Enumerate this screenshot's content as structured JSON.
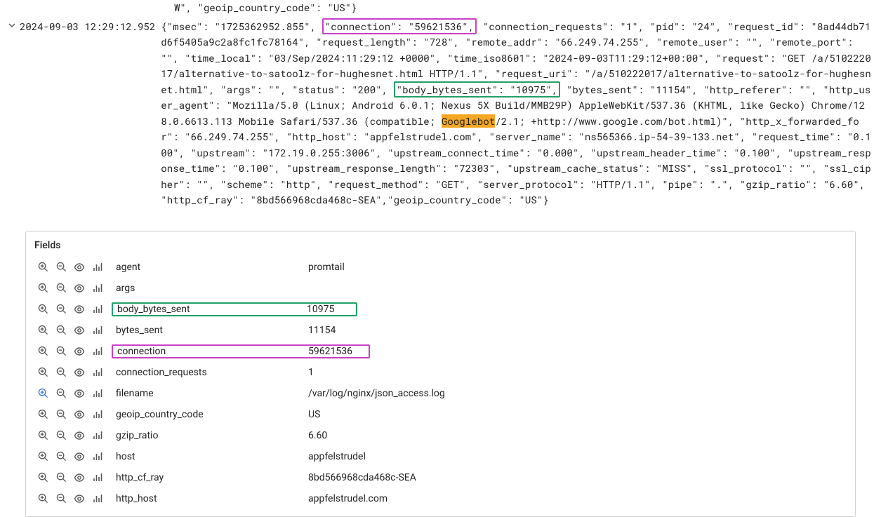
{
  "top_fragment": "W\", \"geoip_country_code\": \"US\"}",
  "timestamp": "2024-09-03 12:29:12.952",
  "log_prefix": "{\"msec\": \"1725362952.855\", ",
  "log_conn_span": "\"connection\": \"59621536\",",
  "log_mid1": " \"connection_requests\": \"1\", \"pid\": \"24\", \"request_id\": \"8ad44db71d6f5405a9c2a8fc1fc78164\", \"request_length\": \"728\", \"remote_addr\": \"66.249.74.255\", \"remote_user\": \"\", \"remote_port\": \"\", \"time_local\": \"03/Sep/2024:11:29:12 +0000\", \"time_iso8601\": \"2024-09-03T11:29:12+00:00\", \"request\": \"GET /a/510222017/alternative-to-satoolz-for-hughesnet.html HTTP/1.1\", \"request_uri\": \"/a/510222017/alternative-to-satoolz-for-hughesnet.html\", \"args\": \"\", \"status\": \"200\", ",
  "log_body_span": "\"body_bytes_sent\": \"10975\",",
  "log_mid2": " \"bytes_sent\": \"11154\", \"http_referer\": \"\", \"http_user_agent\": \"Mozilla/5.0 (Linux; Android 6.0.1; Nexus 5X Build/MMB29P) AppleWebKit/537.36 (KHTML, like Gecko) Chrome/128.0.6613.113 Mobile Safari/537.36 (compatible; ",
  "log_googlebot": "Googlebot",
  "log_suffix": "/2.1; +http://www.google.com/bot.html)\", \"http_x_forwarded_for\": \"66.249.74.255\", \"http_host\": \"appfelstrudel.com\", \"server_name\": \"ns565366.ip-54-39-133.net\", \"request_time\": \"0.100\", \"upstream\": \"172.19.0.255:3006\", \"upstream_connect_time\": \"0.000\", \"upstream_header_time\": \"0.100\", \"upstream_response_time\": \"0.100\", \"upstream_response_length\": \"72303\", \"upstream_cache_status\": \"MISS\", \"ssl_protocol\": \"\", \"ssl_cipher\": \"\", \"scheme\": \"http\", \"request_method\": \"GET\", \"server_protocol\": \"HTTP/1.1\", \"pipe\": \".\", \"gzip_ratio\": \"6.60\", \"http_cf_ray\": \"8bd566968cda468c-SEA\",\"geoip_country_code\": \"US\"}",
  "fields_title": "Fields",
  "fields": [
    {
      "name": "agent",
      "value": "promtail",
      "highlight": "",
      "active_in": false
    },
    {
      "name": "args",
      "value": "",
      "highlight": "",
      "active_in": false
    },
    {
      "name": "body_bytes_sent",
      "value": "10975",
      "highlight": "green",
      "active_in": false
    },
    {
      "name": "bytes_sent",
      "value": "11154",
      "highlight": "",
      "active_in": false
    },
    {
      "name": "connection",
      "value": "59621536",
      "highlight": "magenta",
      "active_in": false
    },
    {
      "name": "connection_requests",
      "value": "1",
      "highlight": "",
      "active_in": false
    },
    {
      "name": "filename",
      "value": "/var/log/nginx/json_access.log",
      "highlight": "",
      "active_in": true
    },
    {
      "name": "geoip_country_code",
      "value": "US",
      "highlight": "",
      "active_in": false
    },
    {
      "name": "gzip_ratio",
      "value": "6.60",
      "highlight": "",
      "active_in": false
    },
    {
      "name": "host",
      "value": "appfelstrudel",
      "highlight": "",
      "active_in": false
    },
    {
      "name": "http_cf_ray",
      "value": "8bd566968cda468c-SEA",
      "highlight": "",
      "active_in": false
    },
    {
      "name": "http_host",
      "value": "appfelstrudel.com",
      "highlight": "",
      "active_in": false
    }
  ]
}
